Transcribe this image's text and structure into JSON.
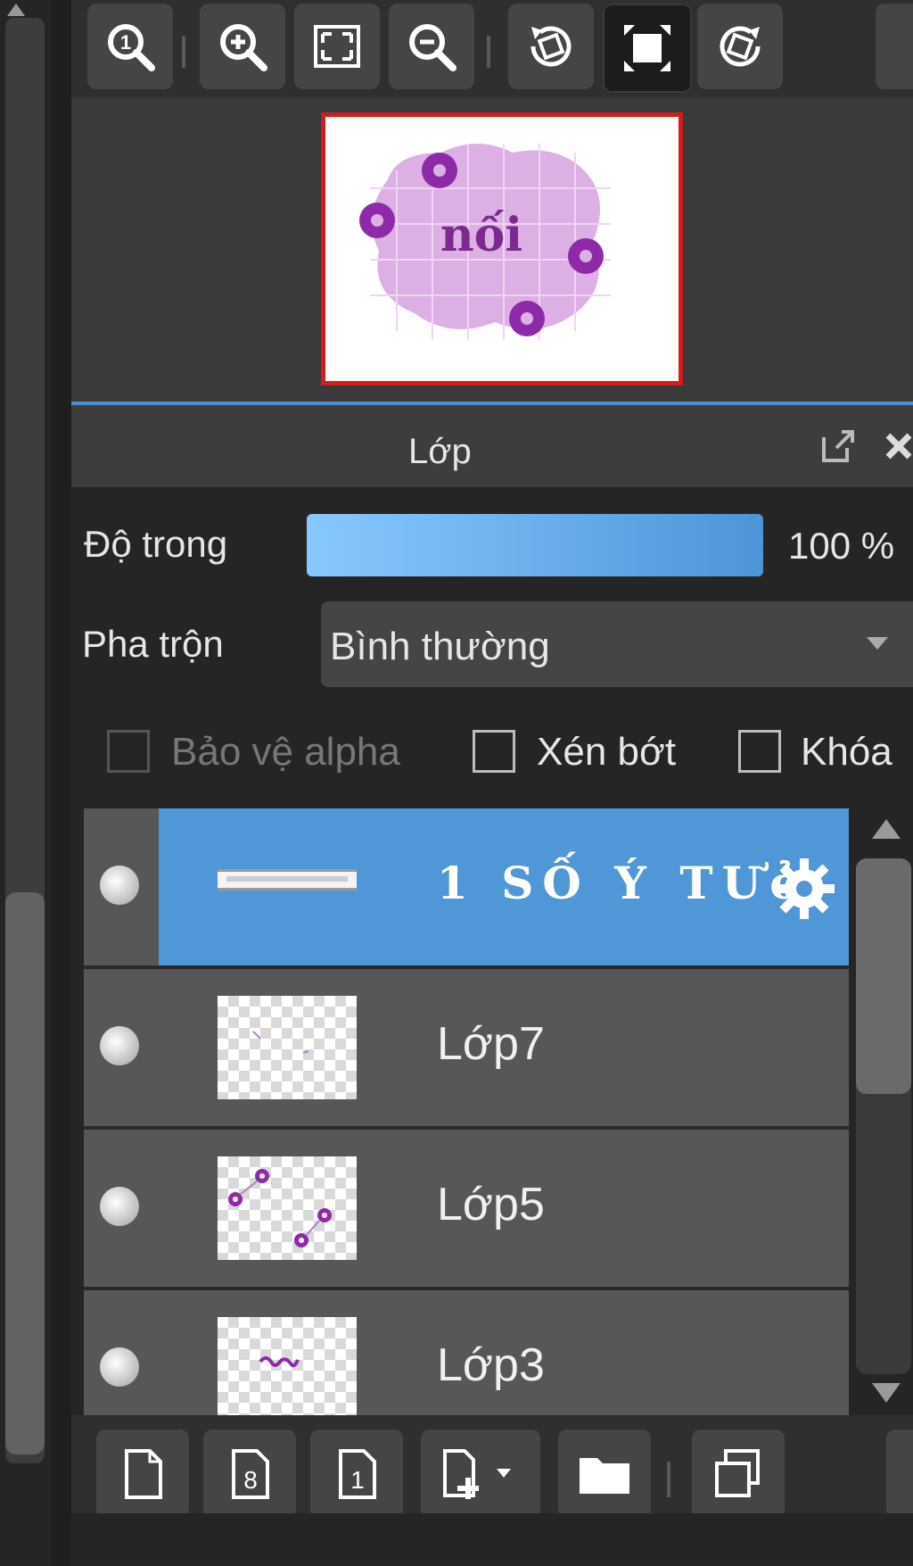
{
  "toolbar": {
    "buttons": [
      {
        "icon": "zoom-actual-size-icon",
        "label": "1"
      },
      {
        "icon": "zoom-in-icon"
      },
      {
        "icon": "fit-to-window-icon"
      },
      {
        "icon": "zoom-out-icon"
      },
      {
        "icon": "rotate-left-icon"
      },
      {
        "icon": "fullscreen-icon"
      },
      {
        "icon": "rotate-right-icon"
      }
    ]
  },
  "navigator": {
    "preview_text": "nối"
  },
  "layers_panel": {
    "title": "Lớp",
    "opacity_label": "Độ trong",
    "opacity_value": "100 %",
    "opacity_fraction": 1.0,
    "blend_label": "Pha trộn",
    "blend_value": "Bình thường",
    "protect_alpha_label": "Bảo vệ alpha",
    "clipping_label": "Xén bớt",
    "lock_label": "Khóa",
    "layers": [
      {
        "name": "1 SỐ Ý TƯở",
        "selected": true,
        "settings_icon": "gear-icon"
      },
      {
        "name": "Lớp7",
        "selected": false
      },
      {
        "name": "Lớp5",
        "selected": false
      },
      {
        "name": "Lớp3",
        "selected": false
      }
    ]
  },
  "bottom_toolbar": {
    "new_8bit_label": "8",
    "new_1bit_label": "1",
    "buttons": [
      "new-layer-icon",
      "new-8bit-layer-icon",
      "new-1bit-layer-icon",
      "add-layer-dropdown-icon",
      "new-folder-icon",
      "duplicate-layer-icon"
    ]
  },
  "colors": {
    "accent": "#4f97d6",
    "preview_border": "#d21d1d",
    "purple": "#8e2aa8"
  }
}
